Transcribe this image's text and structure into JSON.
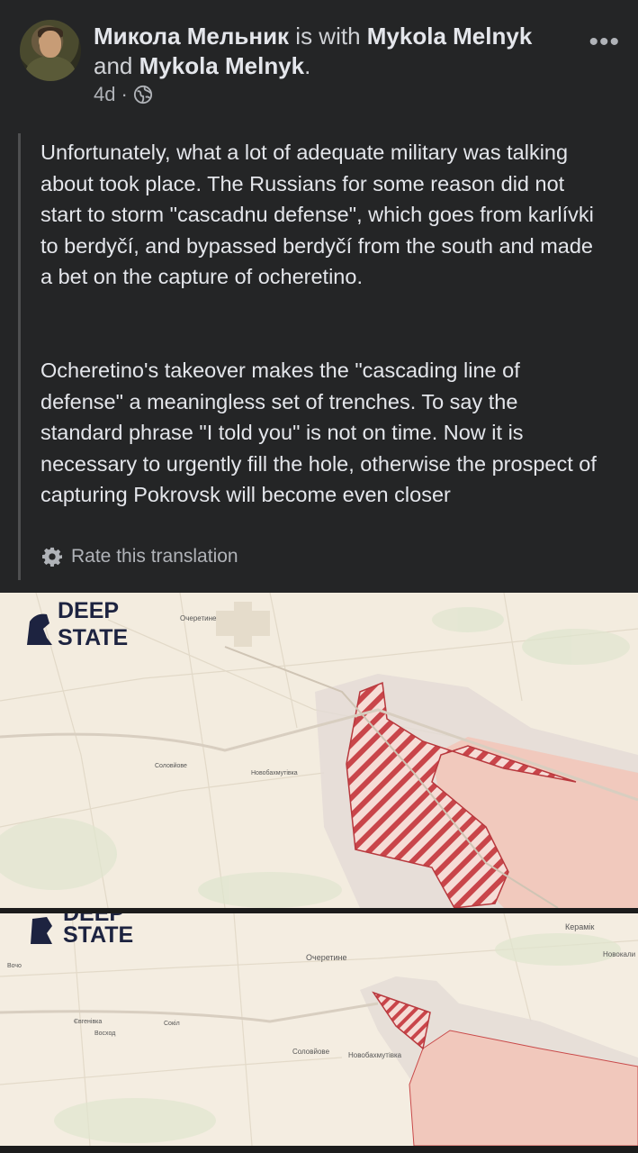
{
  "post": {
    "author": "Микола Мельник",
    "with_text": " is with ",
    "tag1": "Mykola Melnyk",
    "and_text": "and ",
    "tag2": "Mykola Melnyk",
    "tag_end": ".",
    "time": "4d",
    "separator": "·",
    "more_label": "•••"
  },
  "translation": {
    "paragraph1": "Unfortunately, what a lot of adequate military was talking about took place. The Russians for some reason did not start to storm \"cascadnu defense\", which goes from karlívki to berdyčí, and bypassed berdyčí from the south and made a bet on the capture of ocheretino.",
    "paragraph2": "Ocheretino's takeover makes the \"cascading line of defense\" a meaningless set of trenches. To say the standard phrase \"I told you\" is not on time. Now it is necessary to urgently fill the hole, otherwise the prospect of capturing Pokrovsk will become even closer",
    "rate_label": "Rate this translation"
  },
  "map1": {
    "logo_line1": "DEEP",
    "logo_line2": "STATE",
    "place_ocheretyne": "Очеретине",
    "place_soloviove": "Соловйове",
    "place_novobakhmutivka": "Новобахмутівка"
  },
  "map2": {
    "logo_line1": "DEEP",
    "logo_line2": "STATE",
    "place_ocheretyne": "Очеретине",
    "place_keramik": "Керамік",
    "place_novokali": "Новокали",
    "place_vocho": "Вочо",
    "place_yevhenivka": "Євгенівка",
    "place_voskhod": "Восход",
    "place_sokil": "Сокіл",
    "place_soloviove": "Соловйове",
    "place_novobakhmutivka": "Новобахмутівка"
  },
  "colors": {
    "background": "#242526",
    "text": "#e4e6eb",
    "secondary": "#b0b3b8",
    "occupied": "#e8b4a8",
    "contested": "#c94a4a"
  }
}
